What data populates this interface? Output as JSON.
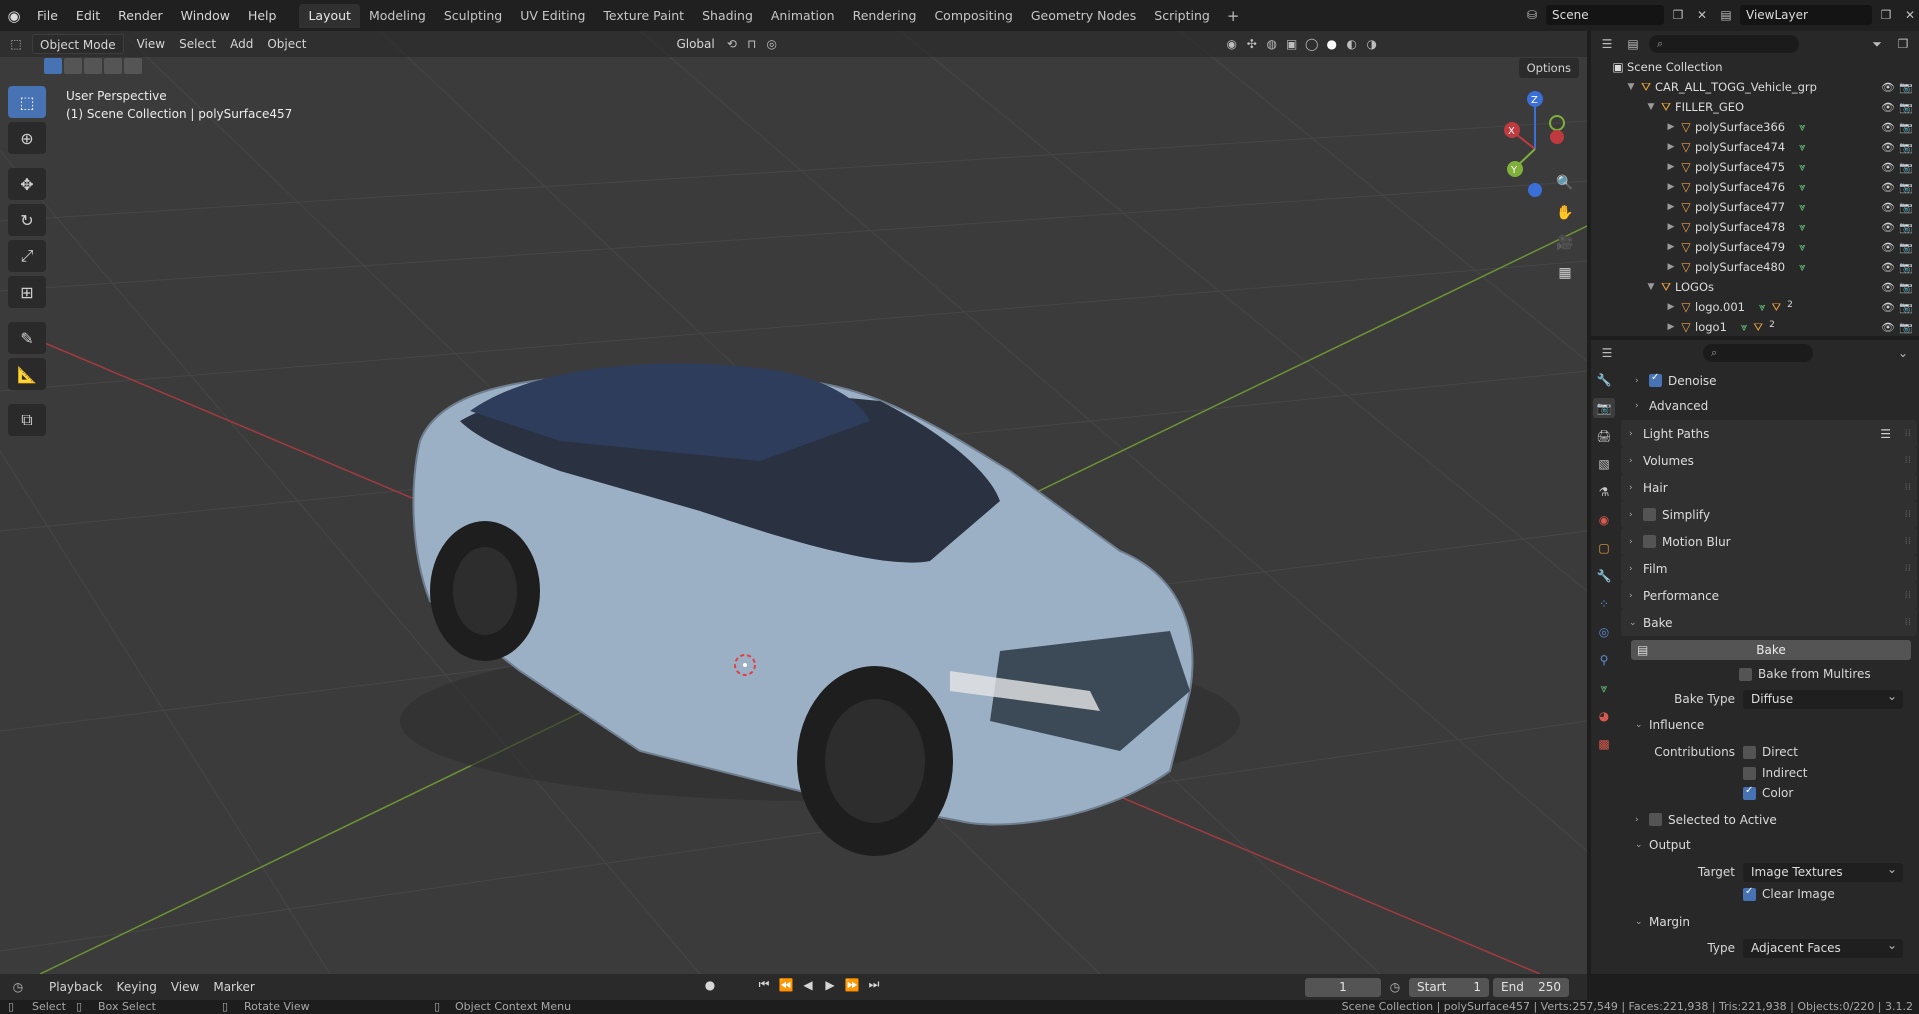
{
  "menu": [
    "File",
    "Edit",
    "Render",
    "Window",
    "Help"
  ],
  "workspaces": [
    "Layout",
    "Modeling",
    "Sculpting",
    "UV Editing",
    "Texture Paint",
    "Shading",
    "Animation",
    "Rendering",
    "Compositing",
    "Geometry Nodes",
    "Scripting"
  ],
  "active_workspace": "Layout",
  "scene": "Scene",
  "view_layer": "ViewLayer",
  "viewport_header": {
    "mode": "Object Mode",
    "menus": [
      "View",
      "Select",
      "Add",
      "Object"
    ],
    "orientation": "Global",
    "options": "Options"
  },
  "viewport_info": {
    "line1": "User Perspective",
    "line2": "(1) Scene Collection | polySurface457"
  },
  "gizmo": {
    "x": "X",
    "y": "Y",
    "z": "Z"
  },
  "outliner": {
    "root": "Scene Collection",
    "rows": [
      {
        "label": "CAR_ALL_TOGG_Vehicle_grp",
        "indent": 1,
        "type": "collection",
        "expanded": true
      },
      {
        "label": "FILLER_GEO",
        "indent": 2,
        "type": "collection",
        "expanded": true
      },
      {
        "label": "polySurface366",
        "indent": 3,
        "type": "mesh"
      },
      {
        "label": "polySurface474",
        "indent": 3,
        "type": "mesh"
      },
      {
        "label": "polySurface475",
        "indent": 3,
        "type": "mesh"
      },
      {
        "label": "polySurface476",
        "indent": 3,
        "type": "mesh"
      },
      {
        "label": "polySurface477",
        "indent": 3,
        "type": "mesh"
      },
      {
        "label": "polySurface478",
        "indent": 3,
        "type": "mesh"
      },
      {
        "label": "polySurface479",
        "indent": 3,
        "type": "mesh"
      },
      {
        "label": "polySurface480",
        "indent": 3,
        "type": "mesh"
      },
      {
        "label": "LOGOs",
        "indent": 2,
        "type": "collection",
        "expanded": true
      },
      {
        "label": "logo.001",
        "indent": 3,
        "type": "mesh",
        "badge": "2"
      },
      {
        "label": "logo1",
        "indent": 3,
        "type": "mesh",
        "badge": "2"
      }
    ]
  },
  "properties": {
    "denoise": "Denoise",
    "advanced": "Advanced",
    "panels_collapsed": [
      "Light Paths",
      "Volumes",
      "Hair",
      "Simplify",
      "Motion Blur",
      "Film",
      "Performance"
    ],
    "bake": {
      "title": "Bake",
      "button": "Bake",
      "from_multires": "Bake from Multires",
      "type_label": "Bake Type",
      "type_value": "Diffuse",
      "influence": "Influence",
      "contributions_label": "Contributions",
      "direct": "Direct",
      "indirect": "Indirect",
      "color": "Color",
      "selected_to_active": "Selected to Active",
      "output": "Output",
      "target_label": "Target",
      "target_value": "Image Textures",
      "clear_image": "Clear Image",
      "margin": "Margin",
      "margin_type_label": "Type",
      "margin_type_value": "Adjacent Faces"
    }
  },
  "timeline": {
    "menus": [
      "Playback",
      "Keying",
      "View",
      "Marker"
    ],
    "current_frame": "1",
    "start_label": "Start",
    "start": "1",
    "end_label": "End",
    "end": "250"
  },
  "status": {
    "select": "Select",
    "box_select": "Box Select",
    "rotate": "Rotate View",
    "context": "Object Context Menu",
    "stats": "Scene Collection | polySurface457 | Verts:257,549 | Faces:221,938 | Tris:221,938 | Objects:0/220 | 3.1.2"
  },
  "colors": {
    "accent": "#4772b3",
    "viewport_bg": "#3b3b3b",
    "car_body": "#9fb3c8",
    "x_axis": "#c0393f",
    "y_axis": "#7fb03a"
  }
}
